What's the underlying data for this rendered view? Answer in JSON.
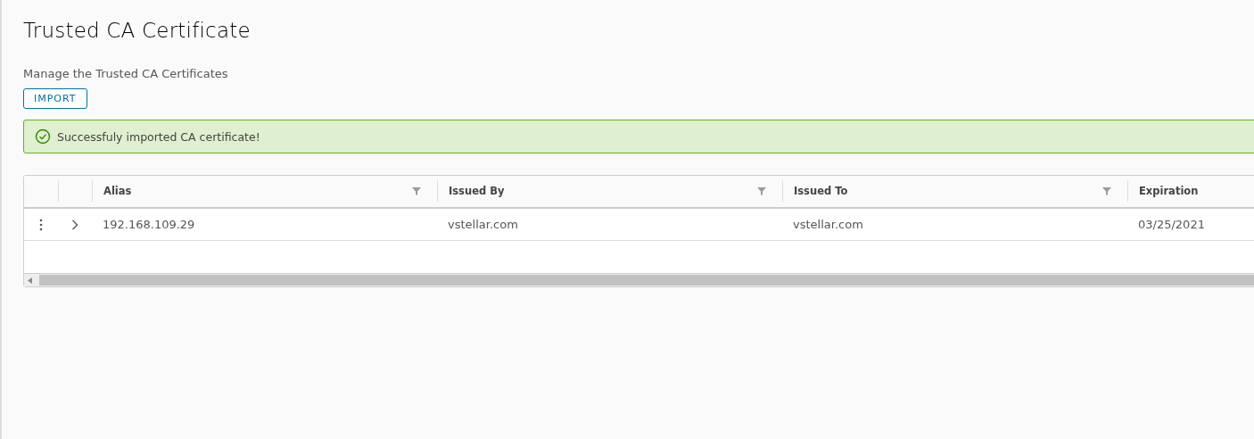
{
  "title": "Trusted CA Certificate",
  "description": "Manage the Trusted CA Certificates",
  "import_button": "IMPORT",
  "alert": {
    "kind": "success",
    "message": "Successfuly imported CA certificate!"
  },
  "table": {
    "columns": [
      {
        "label": "Alias",
        "filter": true
      },
      {
        "label": "Issued By",
        "filter": true
      },
      {
        "label": "Issued To",
        "filter": true
      },
      {
        "label": "Expiration"
      }
    ],
    "rows": [
      {
        "cells": [
          "192.168.109.29",
          "vstellar.com",
          "vstellar.com",
          "03/25/2021"
        ],
        "expanded": false
      }
    ]
  }
}
